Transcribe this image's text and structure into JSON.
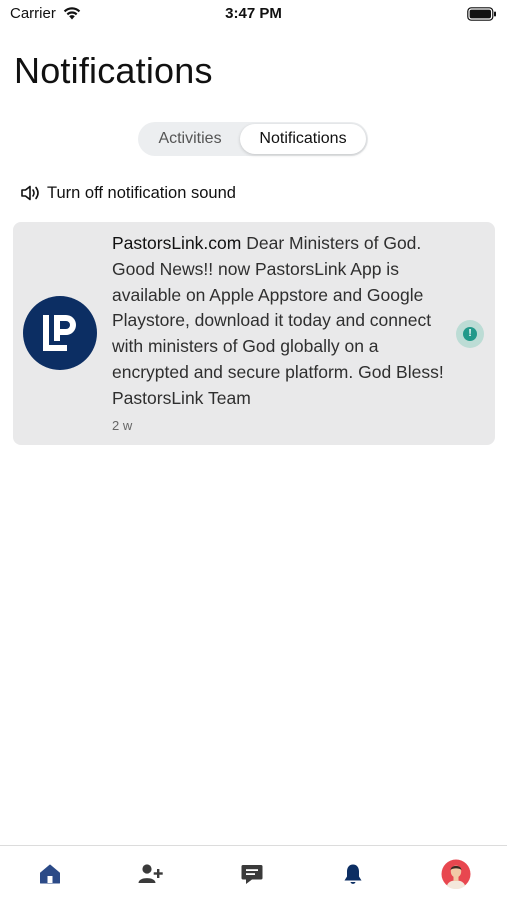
{
  "status_bar": {
    "carrier": "Carrier",
    "time": "3:47 PM"
  },
  "page": {
    "title": "Notifications"
  },
  "segments": {
    "activities": "Activities",
    "notifications": "Notifications",
    "selected": "Notifications"
  },
  "sound_toggle": {
    "label": "Turn off notification sound",
    "icon": "speaker-icon"
  },
  "notifications": [
    {
      "sender": "PastorsLink.com",
      "message": " Dear Ministers of God. Good News!! now PastorsLink App is available on Apple Appstore and Google Playstore, download it today and connect with ministers of God globally on a encrypted and secure platform. God Bless! PastorsLink Team",
      "time": "2 w",
      "unread_badge": "!"
    }
  ],
  "tab_bar": {
    "items": [
      {
        "name": "home",
        "icon": "home-icon",
        "active": true
      },
      {
        "name": "add-friend",
        "icon": "add-user-icon",
        "active": false
      },
      {
        "name": "messages",
        "icon": "chat-icon",
        "active": false
      },
      {
        "name": "notifications",
        "icon": "bell-icon",
        "active": false
      },
      {
        "name": "profile",
        "icon": "avatar-icon",
        "active": false
      }
    ]
  },
  "colors": {
    "accent": "#0c2e63",
    "card_background": "#e9e9ea",
    "unread_badge": "#22998a",
    "home_active": "#2b4a87"
  }
}
